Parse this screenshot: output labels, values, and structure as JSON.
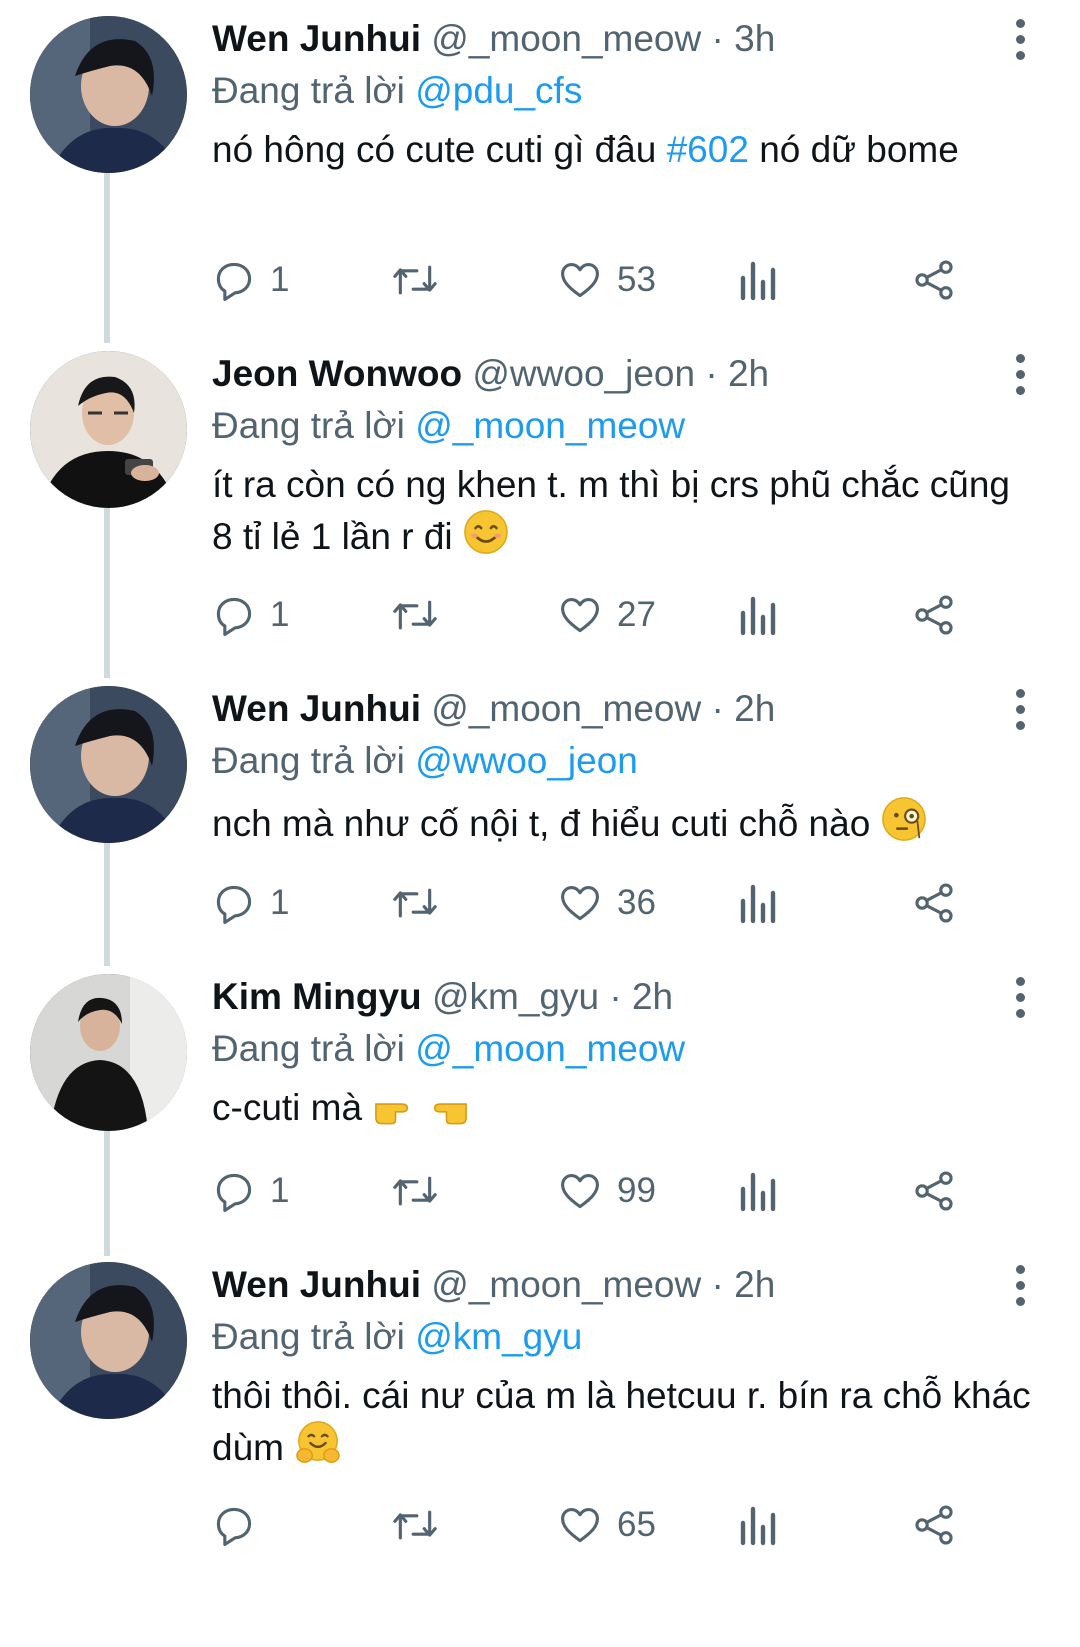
{
  "tweets": [
    {
      "name": "Wen Junhui",
      "handle": "@_moon_meow",
      "sep": "·",
      "time": "3h",
      "reply_prefix": "Đang trả lời",
      "reply_to": "@pdu_cfs",
      "text_a": "nó hông có cute cuti gì đâu ",
      "hashtag": "#602",
      "text_b": " nó dữ bome",
      "emoji": "",
      "replies": "1",
      "likes": "53"
    },
    {
      "name": "Jeon Wonwoo",
      "handle": "@wwoo_jeon",
      "sep": "·",
      "time": "2h",
      "reply_prefix": "Đang trả lời",
      "reply_to": "@_moon_meow",
      "text_a": "ít ra còn có ng khen t. m thì bị crs phũ chắc cũng 8 tỉ lẻ 1 lần r đi ",
      "hashtag": "",
      "text_b": "",
      "emoji": "smiling-face",
      "replies": "1",
      "likes": "27"
    },
    {
      "name": "Wen Junhui",
      "handle": "@_moon_meow",
      "sep": "·",
      "time": "2h",
      "reply_prefix": "Đang trả lời",
      "reply_to": "@wwoo_jeon",
      "text_a": "nch mà như cố nội t, đ hiểu cuti chỗ nào ",
      "hashtag": "",
      "text_b": "",
      "emoji": "monocle-face",
      "replies": "1",
      "likes": "36"
    },
    {
      "name": "Kim Mingyu",
      "handle": "@km_gyu",
      "sep": "·",
      "time": "2h",
      "reply_prefix": "Đang trả lời",
      "reply_to": "@_moon_meow",
      "text_a": "c-cuti mà ",
      "hashtag": "",
      "text_b": "",
      "emoji": "pointing-fingers",
      "replies": "1",
      "likes": "99"
    },
    {
      "name": "Wen Junhui",
      "handle": "@_moon_meow",
      "sep": "·",
      "time": "2h",
      "reply_prefix": "Đang trả lời",
      "reply_to": "@km_gyu",
      "text_a": "thôi thôi. cái nư của m là hetcuu r. bín ra chỗ khác dùm ",
      "hashtag": "",
      "text_b": "",
      "emoji": "hugging-face",
      "replies": "",
      "likes": "65"
    }
  ],
  "colors": {
    "accent": "#1d9bf0",
    "muted": "#536471",
    "thread": "#cfd9de"
  }
}
